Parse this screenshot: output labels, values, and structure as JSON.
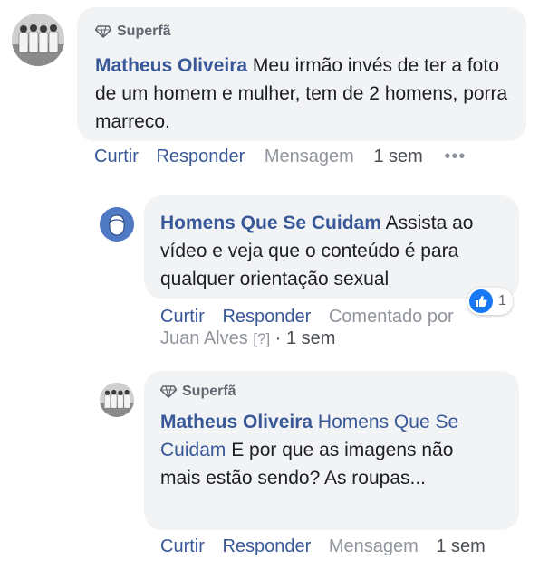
{
  "thread": [
    {
      "badge": "Superfã",
      "author": "Matheus Oliveira",
      "text": "Meu irmão invés de ter a foto de um homem e mulher, tem de 2 homens, porra marreco.",
      "actions": {
        "like": "Curtir",
        "reply": "Responder",
        "message": "Mensagem",
        "time": "1 sem",
        "more": "•••"
      }
    },
    {
      "author": "Homens Que Se Cuidam",
      "text": "Assista ao vídeo e veja que o conteúdo é para qualquer orientação sexual",
      "reaction_count": "1",
      "actions": {
        "like": "Curtir",
        "reply": "Responder",
        "commented_by": "Comentado por",
        "commenter": "Juan Alves",
        "marker": "[?]",
        "sep": "·",
        "time": "1 sem"
      }
    },
    {
      "badge": "Superfã",
      "author": "Matheus Oliveira",
      "tag": "Homens Que Se Cuidam",
      "text": "E por que as imagens não mais estão sendo? As roupas...",
      "actions": {
        "like": "Curtir",
        "reply": "Responder",
        "message": "Mensagem",
        "time": "1 sem"
      }
    }
  ],
  "colors": {
    "link": "#385898",
    "bubble": "#f2f3f5",
    "muted": "#90949c",
    "like_blue": "#1877f2"
  }
}
